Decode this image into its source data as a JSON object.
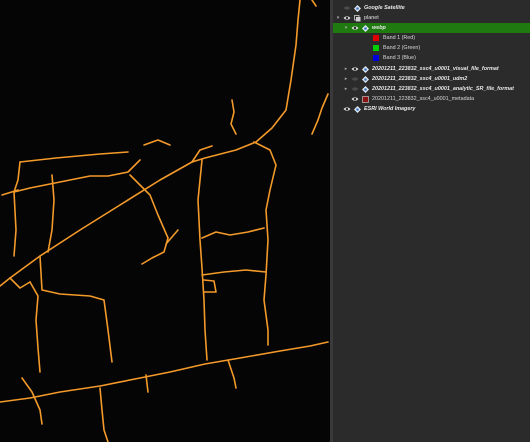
{
  "layers": [
    {
      "id": "google",
      "label": "Google Satellite",
      "depth": 0,
      "arrow": "",
      "visible": false,
      "icon": "xyz-tile-icon",
      "style": "bold"
    },
    {
      "id": "planet",
      "label": "planet",
      "depth": 0,
      "arrow": "▾",
      "visible": true,
      "icon": "group-icon",
      "style": "normal"
    },
    {
      "id": "webp",
      "label": "webp",
      "depth": 1,
      "arrow": "▾",
      "visible": true,
      "icon": "xyz-tile-icon",
      "style": "bold",
      "selected": true
    },
    {
      "id": "band1",
      "label": "Band 1 (Red)",
      "depth": 2,
      "swatch": "#e00000",
      "style": "normal"
    },
    {
      "id": "band2",
      "label": "Band 2 (Green)",
      "depth": 2,
      "swatch": "#00cc00",
      "style": "normal"
    },
    {
      "id": "band3",
      "label": "Band 3 (Blue)",
      "depth": 2,
      "swatch": "#0000dd",
      "style": "normal"
    },
    {
      "id": "visual",
      "label": "20201211_223832_ssc4_u0001_visual_file_format",
      "depth": 1,
      "arrow": "▸",
      "visible": true,
      "icon": "xyz-tile-icon",
      "style": "bold"
    },
    {
      "id": "udm2",
      "label": "20201211_223832_ssc4_u0001_udm2",
      "depth": 1,
      "arrow": "▸",
      "visible": false,
      "icon": "xyz-tile-icon",
      "style": "bold"
    },
    {
      "id": "analytic",
      "label": "20201211_223832_ssc4_u0001_analytic_SR_file_format",
      "depth": 1,
      "arrow": "▸",
      "visible": false,
      "icon": "xyz-tile-icon",
      "style": "bold"
    },
    {
      "id": "metadata",
      "label": "20201211_223832_ssc4_u0001_metadata",
      "depth": 1,
      "arrow": "",
      "visible": true,
      "icon": "raster-layer-icon",
      "style": "normal"
    },
    {
      "id": "esri",
      "label": "ESRI World Imagery",
      "depth": 0,
      "arrow": "",
      "visible": true,
      "icon": "xyz-tile-icon",
      "style": "bold"
    }
  ],
  "colors": {
    "road": "#f39a2a",
    "selection": "#1f7a10",
    "panel": "#2b2b2b",
    "map_bg": "#050505"
  }
}
